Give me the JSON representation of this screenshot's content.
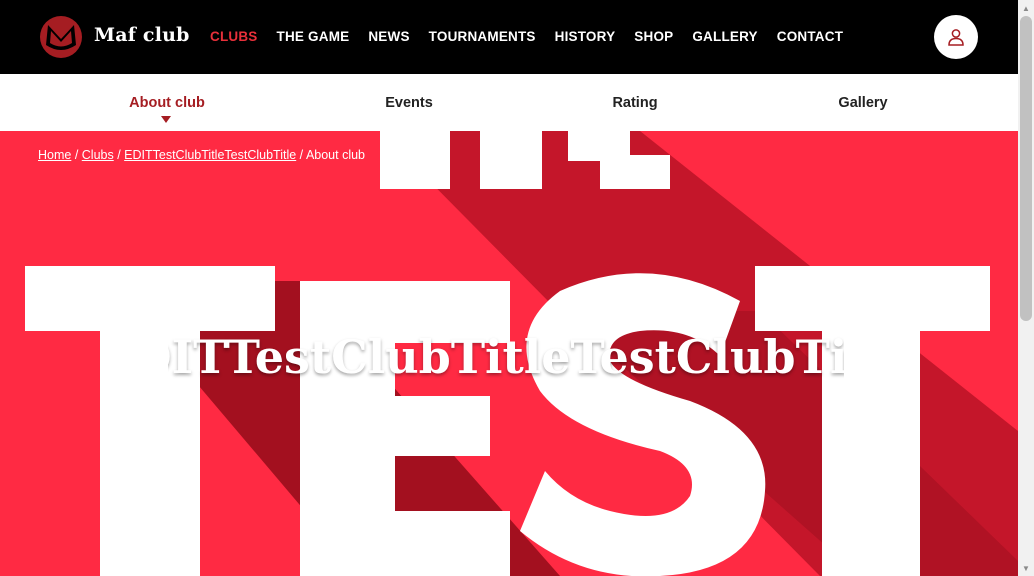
{
  "header": {
    "brand": "Maf club",
    "nav": [
      "CLUBS",
      "THE GAME",
      "NEWS",
      "TOURNAMENTS",
      "HISTORY",
      "SHOP",
      "GALLERY",
      "CONTACT"
    ],
    "active_nav": "CLUBS",
    "user_icon": "user-icon"
  },
  "subnav": {
    "items": [
      "About club",
      "Events",
      "Rating",
      "Gallery"
    ],
    "active": "About club"
  },
  "breadcrumb": {
    "home": "Home",
    "clubs": "Clubs",
    "club": "EDITTestClubTitleTestClubTitle",
    "current": "About club"
  },
  "hero": {
    "title": "EDITTestClubTitleTestClubTitle",
    "image_text_top": "THE",
    "image_text_main": "TEST"
  },
  "colors": {
    "accent": "#e8303a",
    "subnav_active": "#a51d22",
    "hero_bg": "#ff2a43",
    "header_bg": "#000000"
  }
}
